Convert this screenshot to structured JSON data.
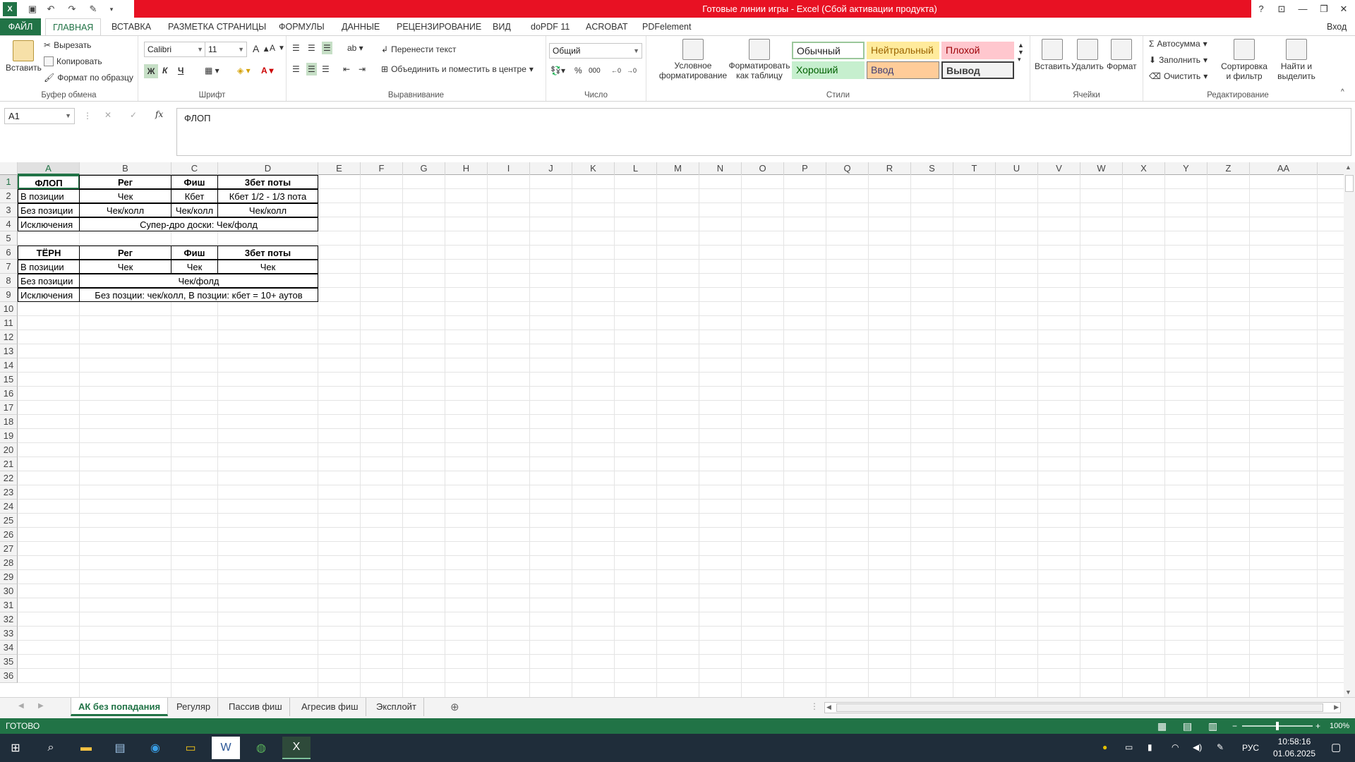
{
  "titlebar": {
    "title": "Готовые линии игры -  Excel (Сбой активации продукта)",
    "help": "?",
    "login": "Вход"
  },
  "tabs": [
    "ФАЙЛ",
    "ГЛАВНАЯ",
    "ВСТАВКА",
    "РАЗМЕТКА СТРАНИЦЫ",
    "ФОРМУЛЫ",
    "ДАННЫЕ",
    "РЕЦЕНЗИРОВАНИЕ",
    "ВИД",
    "doPDF 11",
    "ACROBAT",
    "PDFelement"
  ],
  "ribbon": {
    "clipboard": {
      "paste": "Вставить",
      "cut": "Вырезать",
      "copy": "Копировать",
      "format_painter": "Формат по образцу",
      "label": "Буфер обмена"
    },
    "font": {
      "name": "Calibri",
      "size": "11",
      "bold": "Ж",
      "italic": "К",
      "underline": "Ч",
      "label": "Шрифт"
    },
    "alignment": {
      "wrap": "Перенести текст",
      "merge": "Объединить и поместить в центре",
      "label": "Выравнивание"
    },
    "number": {
      "format": "Общий",
      "percent": "%",
      "thousands": "000",
      "label": "Число"
    },
    "styles": {
      "conditional": "Условное форматирование",
      "as_table": "Форматировать как таблицу",
      "cells": [
        "Обычный",
        "Нейтральный",
        "Плохой",
        "Хороший",
        "Ввод",
        "Вывод"
      ],
      "label": "Стили"
    },
    "cells": {
      "insert": "Вставить",
      "delete": "Удалить",
      "format": "Формат",
      "label": "Ячейки"
    },
    "editing": {
      "autosum": "Автосумма",
      "fill": "Заполнить",
      "clear": "Очистить",
      "sort": "Сортировка и фильтр",
      "find": "Найти и выделить",
      "label": "Редактирование"
    }
  },
  "formula": {
    "namebox": "A1",
    "fx": "fx",
    "value": "ФЛОП"
  },
  "columns": [
    "A",
    "B",
    "C",
    "D",
    "E",
    "F",
    "G",
    "H",
    "I",
    "J",
    "K",
    "L",
    "M",
    "N",
    "O",
    "P",
    "Q",
    "R",
    "S",
    "T",
    "U",
    "V",
    "W",
    "X",
    "Y",
    "Z",
    "AA"
  ],
  "rows": [
    "1",
    "2",
    "3",
    "4",
    "5",
    "6",
    "7",
    "8",
    "9",
    "10",
    "11",
    "12",
    "13",
    "14",
    "15",
    "16",
    "17",
    "18",
    "19",
    "20",
    "21",
    "22",
    "23",
    "24",
    "25",
    "26",
    "27",
    "28",
    "29",
    "30",
    "31",
    "32",
    "33",
    "34",
    "35",
    "36"
  ],
  "table1": {
    "header": [
      "ФЛОП",
      "Рег",
      "Фиш",
      "3бет поты"
    ],
    "r2": [
      "В позиции",
      "Чек",
      "Кбет",
      "Кбет 1/2 - 1/3 пота"
    ],
    "r3": [
      "Без позиции",
      "Чек/колл",
      "Чек/колл",
      "Чек/колл"
    ],
    "r4": [
      "Исключения",
      "Супер-дро доски: Чек/фолд"
    ]
  },
  "table2": {
    "header": [
      "ТЁРН",
      "Рег",
      "Фиш",
      "3бет поты"
    ],
    "r7": [
      "В позиции",
      "Чек",
      "Чек",
      "Чек"
    ],
    "r8": [
      "Без позиции",
      "Чек/фолд"
    ],
    "r9": [
      "Исключения",
      "Без позции: чек/колл, В позции: кбет = 10+ аутов"
    ]
  },
  "sheets": [
    "АК без попадания",
    "Регуляр",
    "Пассив фиш",
    "Агресив фиш",
    "Эксплойт"
  ],
  "status": {
    "ready": "ГОТОВО",
    "zoom": "100%"
  },
  "tray": {
    "lang": "РУС",
    "time": "10:58:16",
    "date": "01.06.2025"
  }
}
